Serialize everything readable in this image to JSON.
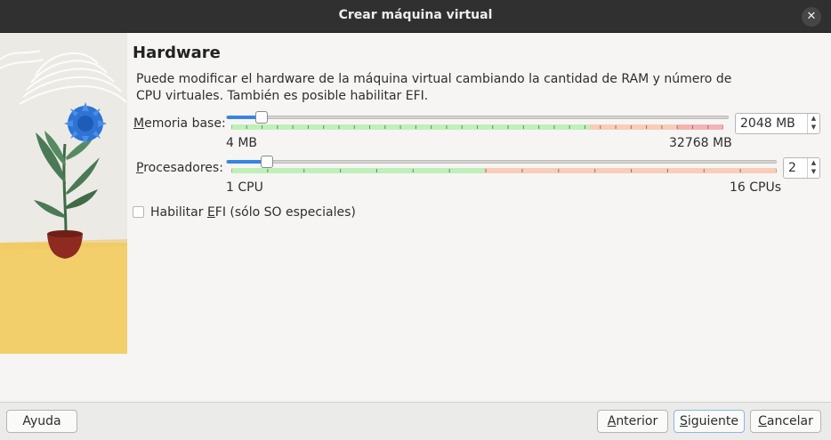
{
  "window": {
    "title": "Crear máquina virtual",
    "close_icon": "close-icon"
  },
  "page": {
    "heading": "Hardware",
    "description": "Puede modificar el hardware de la máquina virtual cambiando la cantidad de RAM y número de CPU virtuales. También es posible habilitar EFI."
  },
  "memory": {
    "label_accel": "M",
    "label_rest": "emoria base:",
    "value": "2048 MB",
    "min_label": "4 MB",
    "max_label": "32768 MB",
    "level_fraction": 0.0625
  },
  "processors": {
    "label_accel": "P",
    "label_rest": "rocesadores:",
    "value": "2",
    "min_label": "1 CPU",
    "max_label": "16 CPUs",
    "level_fraction": 0.0667
  },
  "efi": {
    "label_pre": "Habilitar ",
    "label_accel": "E",
    "label_rest": "FI (sólo SO especiales)",
    "checked": false
  },
  "buttons": {
    "help": "Ayuda",
    "back_accel": "A",
    "back_rest": "nterior",
    "next_accel": "S",
    "next_rest": "iguiente",
    "cancel_accel": "C",
    "cancel_rest": "ancelar"
  },
  "colors": {
    "accent": "#3584e4",
    "safe_zone": "#bff0b8",
    "warn_zone": "#f9cdb8",
    "danger_zone": "#f5b4b4"
  }
}
